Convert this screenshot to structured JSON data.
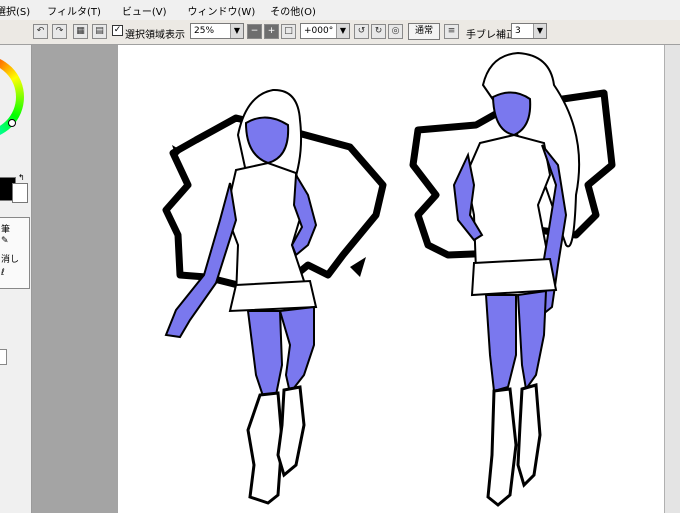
{
  "menu": {
    "items": [
      {
        "label": "選択(S)"
      },
      {
        "label": "フィルタ(T)"
      },
      {
        "label": "ビュー(V)"
      },
      {
        "label": "ウィンドウ(W)"
      },
      {
        "label": "その他(O)"
      }
    ]
  },
  "toolbar": {
    "selection_visible_label": "選択領域表示",
    "selection_visible_checked": "✓",
    "zoom_value": "25%",
    "rotation_value": "+000°",
    "blend_mode_label": "通常",
    "stabilizer_label": "手ブレ補正",
    "stabilizer_value": "3"
  },
  "left_panel": {
    "tool_texts": [
      "筆",
      "消し",
      "ℓ"
    ]
  },
  "colors": {
    "skin": "#7a78ee",
    "ui_bg": "#f0f0f0",
    "canvas_bg": "#a4a4a4"
  }
}
